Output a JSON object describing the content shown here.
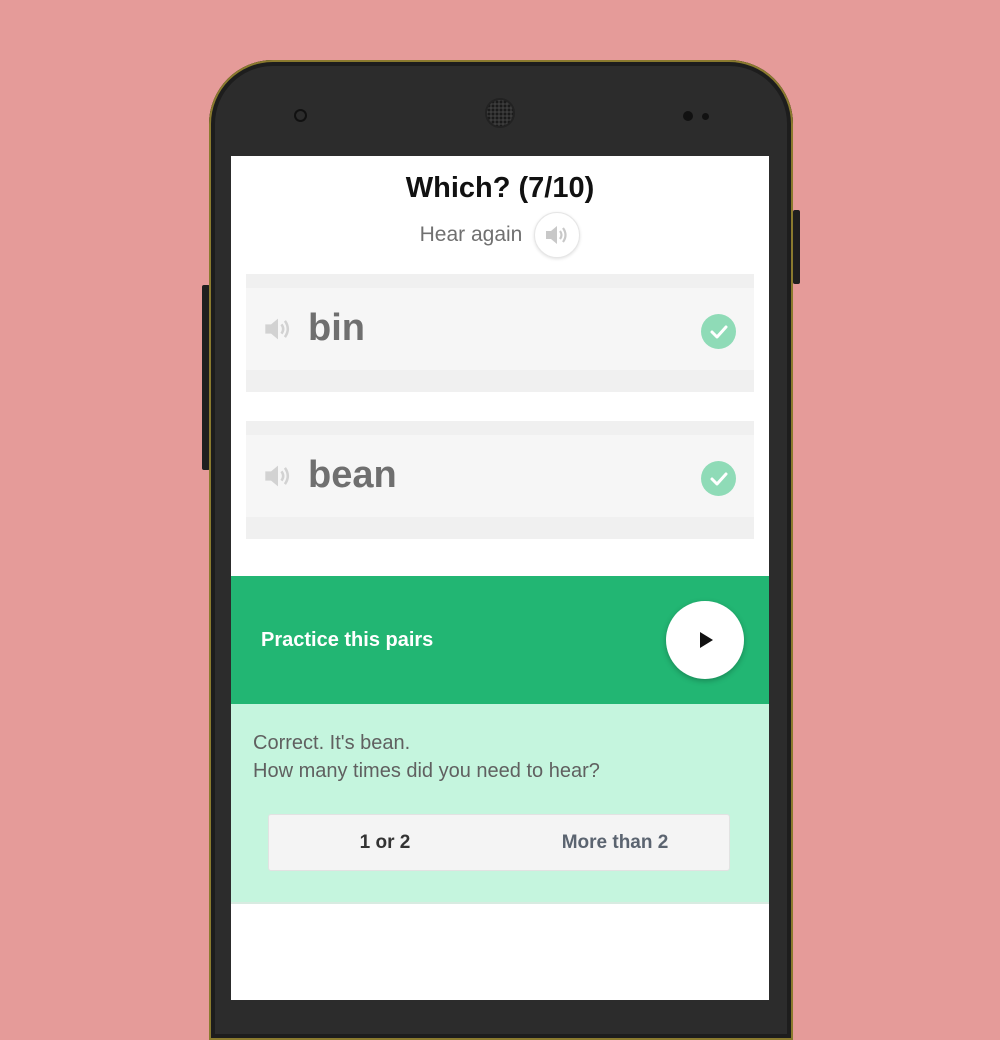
{
  "colors": {
    "background": "#e59b99",
    "accent_green": "#22b673",
    "feedback_bg": "#c5f5de",
    "check_green": "#8fdbb7"
  },
  "quiz": {
    "title": "Which? (7/10)",
    "hear_again_label": "Hear again",
    "hear_again_icon": "speaker-icon"
  },
  "options": [
    {
      "word": "bin",
      "sound_icon": "speaker-icon",
      "status_icon": "check-icon"
    },
    {
      "word": "bean",
      "sound_icon": "speaker-icon",
      "status_icon": "check-icon"
    }
  ],
  "practice": {
    "label": "Practice this pairs",
    "play_icon": "play-icon"
  },
  "feedback": {
    "line1": "Correct. It's bean.",
    "line2": "How many times did you need to hear?",
    "choices": [
      "1 or 2",
      "More than 2"
    ]
  }
}
